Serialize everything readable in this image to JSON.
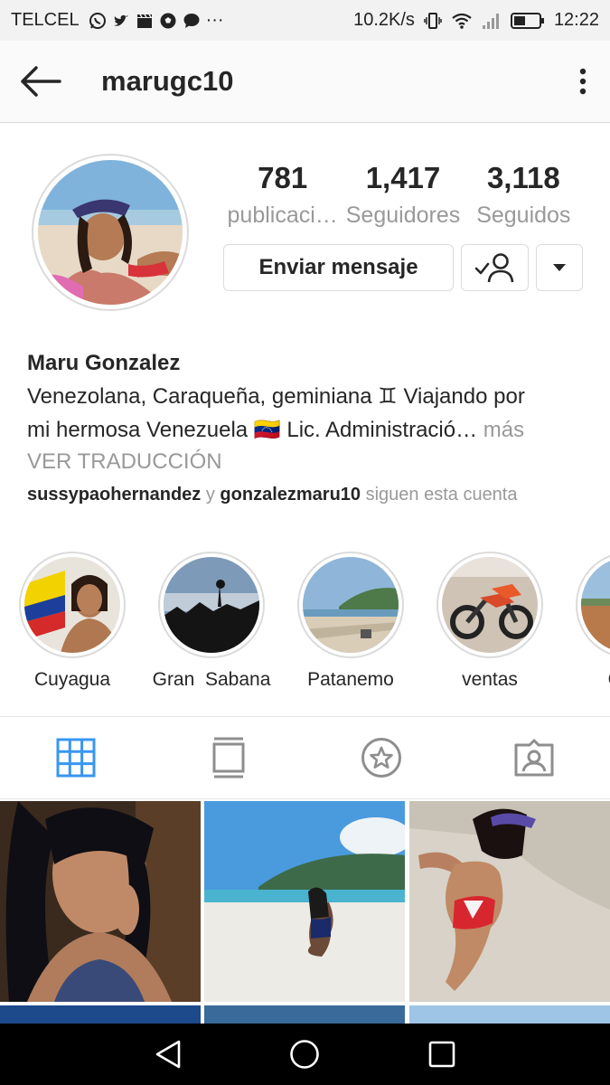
{
  "status_bar": {
    "carrier": "TELCEL",
    "notification_icons": [
      "whatsapp-icon",
      "twitter-icon",
      "clapper-icon",
      "soccer-ball-icon",
      "chat-bubble-icon"
    ],
    "more": "···",
    "network_speed": "10.2K/s",
    "time": "12:22"
  },
  "header": {
    "username": "marugc10"
  },
  "profile": {
    "stats": [
      {
        "value": "781",
        "label": "publicaci…"
      },
      {
        "value": "1,417",
        "label": "Seguidores"
      },
      {
        "value": "3,118",
        "label": "Seguidos"
      }
    ],
    "message_button": "Enviar mensaje",
    "name": "Maru Gonzalez",
    "bio_line1": "Venezolana, Caraqueña, geminiana ♊ Viajando por",
    "bio_line2": "mi hermosa Venezuela 🇻🇪  Lic. Administració…",
    "bio_more": " más",
    "translate": "VER TRADUCCIÓN",
    "followed_by_1": "sussypaohernandez",
    "followed_by_join": " y ",
    "followed_by_2": "gonzalezmaru10",
    "followed_by_suffix": " siguen esta cuenta"
  },
  "highlights": [
    {
      "label": "Cuyagua"
    },
    {
      "label": "Gran  Sabana"
    },
    {
      "label": "Patanemo"
    },
    {
      "label": "ventas"
    },
    {
      "label": "Gran"
    }
  ],
  "tabs": [
    "grid-icon",
    "feed-icon",
    "saved-star-icon",
    "tagged-icon"
  ],
  "colors": {
    "active_tab": "#3897f0",
    "inactive_tab": "#999999",
    "text": "#262626",
    "secondary_text": "#999999",
    "border": "#dbdbdb"
  }
}
